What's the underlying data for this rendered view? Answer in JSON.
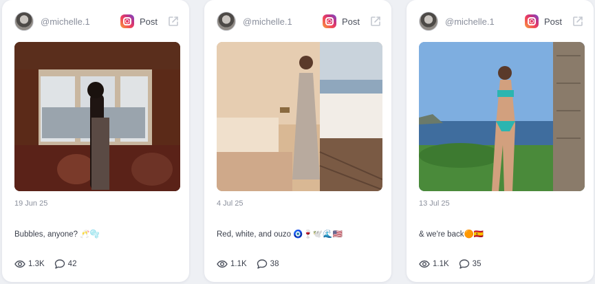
{
  "cards": [
    {
      "username": "@michelle.1",
      "platform_label": "Post",
      "date": "19 Jun 25",
      "caption": "Bubbles, anyone? 🥂🫧",
      "views": "1.3K",
      "comments": "42"
    },
    {
      "username": "@michelle.1",
      "platform_label": "Post",
      "date": "4 Jul 25",
      "caption": "Red, white, and ouzo 🧿🍷🕊️🌊🇺🇸",
      "views": "1.1K",
      "comments": "38"
    },
    {
      "username": "@michelle.1",
      "platform_label": "Post",
      "date": "13 Jul 25",
      "caption": "& we're back🟠🇪🇸",
      "views": "1.1K",
      "comments": "35"
    }
  ],
  "icons": {
    "platform": "instagram-icon",
    "external": "external-link-icon",
    "views": "eye-icon",
    "comments": "comment-icon"
  },
  "colors": {
    "background": "#eef0f4",
    "card": "#ffffff",
    "muted_text": "#8a8f9c",
    "body_text": "#3a3f4b"
  }
}
